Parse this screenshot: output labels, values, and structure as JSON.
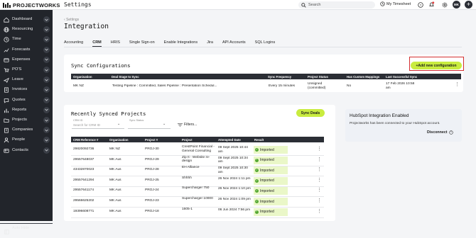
{
  "topbar": {
    "brand": "PROJECTWORKS",
    "title": "Settings",
    "search_placeholder": "Search",
    "timesheet_label": "My Timesheet",
    "avatar_initials": "MK"
  },
  "sidebar": {
    "items": [
      {
        "label": "Dashboard",
        "icon": "home-icon"
      },
      {
        "label": "Resourcing",
        "icon": "globe-icon"
      },
      {
        "label": "Time",
        "icon": "clock-icon"
      },
      {
        "label": "Forecasts",
        "icon": "trend-icon"
      },
      {
        "label": "Expenses",
        "icon": "credit-card-icon"
      },
      {
        "label": "PO'S",
        "icon": "cart-icon"
      },
      {
        "label": "Leave",
        "icon": "plane-icon"
      },
      {
        "label": "Invoices",
        "icon": "invoice-icon"
      },
      {
        "label": "Quotes",
        "icon": "quote-icon"
      },
      {
        "label": "Reports",
        "icon": "bar-chart-icon"
      },
      {
        "label": "Projects",
        "icon": "folder-icon"
      },
      {
        "label": "Companies",
        "icon": "building-icon"
      },
      {
        "label": "People",
        "icon": "person-icon"
      },
      {
        "label": "Contacts",
        "icon": "contact-card-icon"
      }
    ],
    "auto_hide_label": "Auto Hide"
  },
  "breadcrumb": "Settings",
  "page_title": "Integration",
  "tabs": [
    "Accounting",
    "CRM",
    "HRIS",
    "Single Sign-on",
    "Enable Integrations",
    "Jira",
    "API Accounts",
    "SQL Logins"
  ],
  "active_tab": "CRM",
  "sync_config": {
    "title": "Sync Configurations",
    "add_button": "+Add new configuration",
    "columns": [
      "Organisation",
      "Deal Stage to Sync",
      "Sync Frequency",
      "Project Status",
      "Has Custom Mappings",
      "Last Successful Sync"
    ],
    "rows": [
      {
        "organisation": "MK NZ",
        "deal_stage": "Testing Pipeline : Committed, Sales Pipeline : Presentation Schedul...",
        "frequency": "Every 15 minutes",
        "status": "Unsigned (committed)",
        "custom_mappings": "No",
        "last_sync": "17 Feb 2026 10:58 am"
      }
    ]
  },
  "recent_projects": {
    "title": "Recently Synced Projects",
    "sync_button": "Sync Deals",
    "crm_id_label": "CRM ID",
    "crm_id_placeholder": "Search for CRM ID",
    "sync_status_label": "Sync Status",
    "filters_label": "Filters...",
    "columns": [
      "CRM Reference #",
      "Organisation",
      "Project #",
      "Project",
      "Attempted Date",
      "Result"
    ],
    "rows": [
      {
        "ref": "29820092736",
        "org": "MK NZ",
        "num": "PROJ-30",
        "project": "CrestPoint Financial - General Consulting",
        "date": "09 Sept 2025 10:44 am",
        "result": "Imported"
      },
      {
        "ref": "29557648037",
        "org": "MK Aus",
        "num": "PROJ-29",
        "project": "Zip It - Website re-design",
        "date": "09 Sept 2025 10:34 am",
        "result": "Imported"
      },
      {
        "ref": "43432870023",
        "org": "MK Aus",
        "num": "PROJ-28",
        "project": "EH Alliance",
        "date": "09 Sept 2025 10:30 am",
        "result": "Imported"
      },
      {
        "ref": "29557641294",
        "org": "MK Aus",
        "num": "PROJ-25",
        "project": "Shhhh",
        "date": "26 Nov 2024 1:11 pm",
        "result": "Imported"
      },
      {
        "ref": "29557641174",
        "org": "MK Aus",
        "num": "PROJ-24",
        "project": "Supercharger 750",
        "date": "26 Nov 2024 1:10 pm",
        "result": "Imported"
      },
      {
        "ref": "29566625202",
        "org": "MK Aus",
        "num": "PROJ-23",
        "project": "Supercharger 10000",
        "date": "26 Nov 2024 1:09 pm",
        "result": "Imported"
      },
      {
        "ref": "19396608771",
        "org": "MK Aus",
        "num": "PROJ-18",
        "project": "1605-1",
        "date": "06 Jun 2024 7:56 pm",
        "result": "Imported"
      }
    ]
  },
  "hubspot": {
    "title": "HubSpot Integration Enabled",
    "message": "Projectworks has been connected to your HubSpot account.",
    "disconnect_label": "Disconnect"
  },
  "colors": {
    "sidebar": "#22252b",
    "accent": "#c9ec3f",
    "table_header": "#2b2e35",
    "success": "#55a832",
    "highlight": "#d32f2f"
  }
}
